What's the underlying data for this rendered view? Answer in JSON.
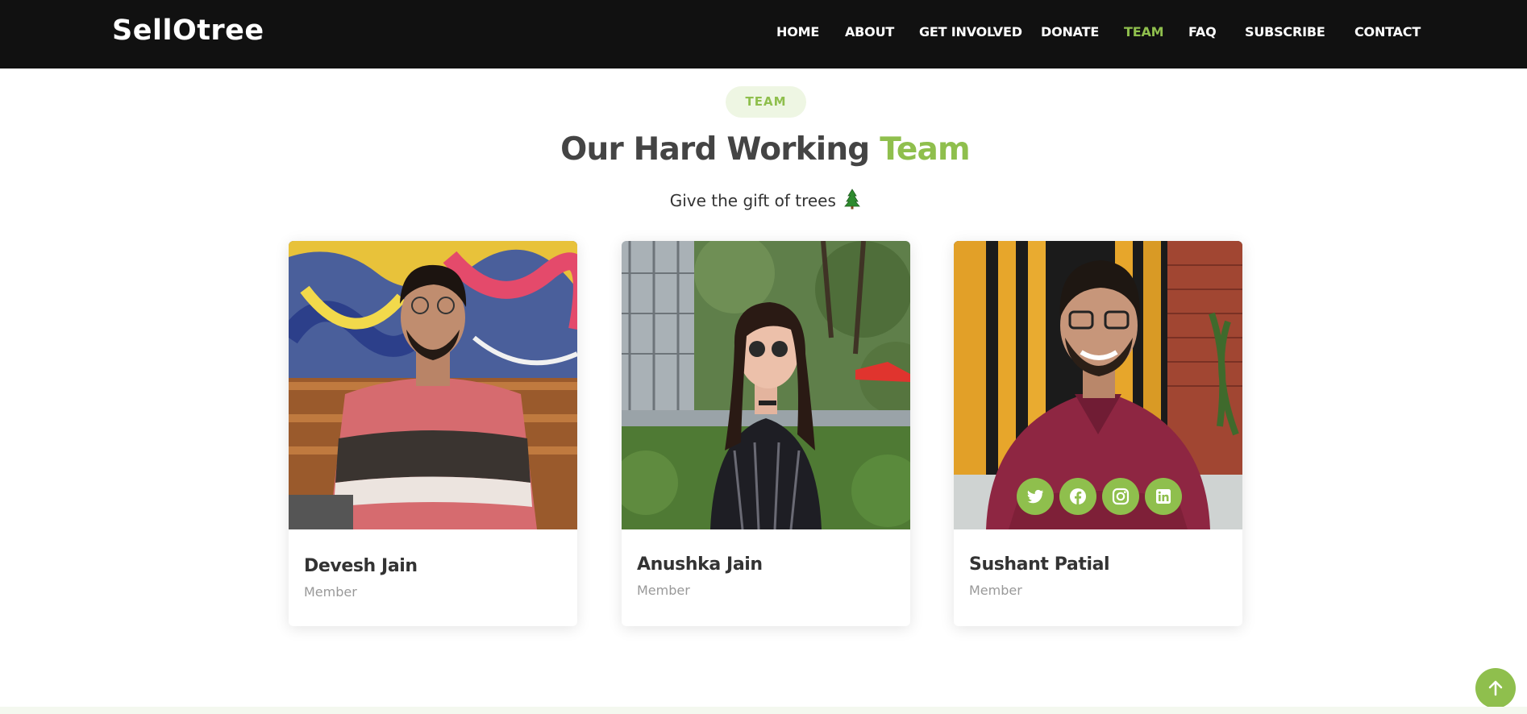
{
  "brand": {
    "logo": "SellOtree"
  },
  "nav": {
    "items": [
      {
        "label": "HOME"
      },
      {
        "label": "ABOUT"
      },
      {
        "label": "GET INVOLVED"
      },
      {
        "label": "DONATE"
      },
      {
        "label": "TEAM",
        "active": true
      },
      {
        "label": "FAQ"
      },
      {
        "label": "SUBSCRIBE"
      },
      {
        "label": "CONTACT"
      }
    ]
  },
  "section": {
    "badge": "TEAM",
    "title_main": "Our Hard Working ",
    "title_accent": "Team",
    "subtitle": "Give the gift of trees",
    "subtitle_icon": "evergreen-tree-icon"
  },
  "team": [
    {
      "name": "Devesh Jain",
      "role": "Member"
    },
    {
      "name": "Anushka Jain",
      "role": "Member"
    },
    {
      "name": "Sushant Patial",
      "role": "Member",
      "socials": [
        "twitter-icon",
        "facebook-icon",
        "instagram-icon",
        "linkedin-icon"
      ]
    }
  ],
  "colors": {
    "accent": "#8fbf4d",
    "navbar": "#111111",
    "heading": "#444444"
  },
  "scroll_top_icon": "arrow-up-icon"
}
